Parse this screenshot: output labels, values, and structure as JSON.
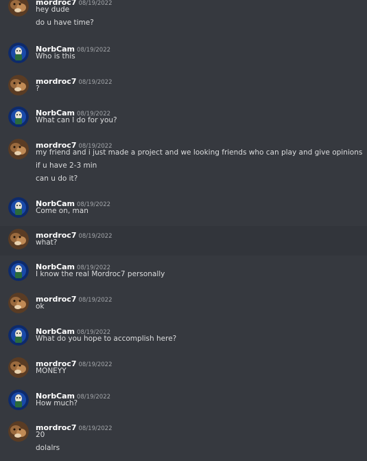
{
  "users": {
    "mordroc": {
      "name": "mordroc7",
      "avatar_icon": "brown-dog-avatar-icon"
    },
    "norb": {
      "name": "NorbCam",
      "avatar_icon": "blue-cave-figure-avatar-icon"
    }
  },
  "messages": [
    {
      "author": "mordroc7",
      "timestamp": "08/19/2022",
      "lines": [
        "hey dude",
        "do u have time?"
      ]
    },
    {
      "author": "NorbCam",
      "timestamp": "08/19/2022",
      "lines": [
        "Who is this"
      ]
    },
    {
      "author": "mordroc7",
      "timestamp": "08/19/2022",
      "lines": [
        "?"
      ]
    },
    {
      "author": "NorbCam",
      "timestamp": "08/19/2022",
      "lines": [
        "What can I do for you?"
      ]
    },
    {
      "author": "mordroc7",
      "timestamp": "08/19/2022",
      "lines": [
        "my friend and i just made a project and we looking friends who can play and give opinions",
        "if u have 2-3 min",
        "can u do it?"
      ]
    },
    {
      "author": "NorbCam",
      "timestamp": "08/19/2022",
      "lines": [
        "Come on, man"
      ]
    },
    {
      "author": "mordroc7",
      "timestamp": "08/19/2022",
      "lines": [
        "what?"
      ]
    },
    {
      "author": "NorbCam",
      "timestamp": "08/19/2022",
      "lines": [
        "I know the real Mordroc7 personally"
      ]
    },
    {
      "author": "mordroc7",
      "timestamp": "08/19/2022",
      "lines": [
        "ok"
      ]
    },
    {
      "author": "NorbCam",
      "timestamp": "08/19/2022",
      "lines": [
        "What do you hope to accomplish here?"
      ]
    },
    {
      "author": "mordroc7",
      "timestamp": "08/19/2022",
      "lines": [
        "MONEYY"
      ]
    },
    {
      "author": "NorbCam",
      "timestamp": "08/19/2022",
      "lines": [
        "How much?"
      ]
    },
    {
      "author": "mordroc7",
      "timestamp": "08/19/2022",
      "lines": [
        "20",
        "dolalrs"
      ]
    }
  ]
}
